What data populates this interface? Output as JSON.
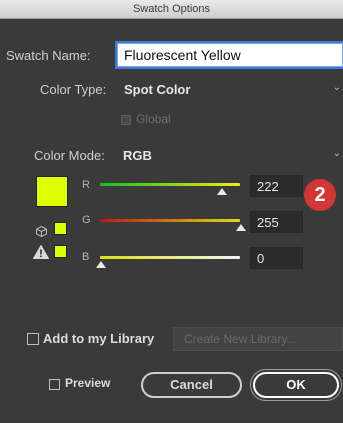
{
  "window": {
    "title": "Swatch Options"
  },
  "form": {
    "swatch_name_label": "Swatch Name:",
    "swatch_name_value": "Fluorescent Yellow",
    "color_type_label": "Color Type:",
    "color_type_value": "Spot Color",
    "global_label": "Global",
    "global_checked": false,
    "color_mode_label": "Color Mode:",
    "color_mode_value": "RGB"
  },
  "channels": [
    {
      "label": "R",
      "value": "222"
    },
    {
      "label": "G",
      "value": "255"
    },
    {
      "label": "B",
      "value": "0"
    }
  ],
  "swatch": {
    "color": "#deff00"
  },
  "annotation": {
    "badge": "2",
    "color": "#d43634"
  },
  "library": {
    "add_label": "Add to my Library",
    "create_label": "Create New Library..."
  },
  "footer": {
    "preview_label": "Preview",
    "cancel_label": "Cancel",
    "ok_label": "OK"
  }
}
